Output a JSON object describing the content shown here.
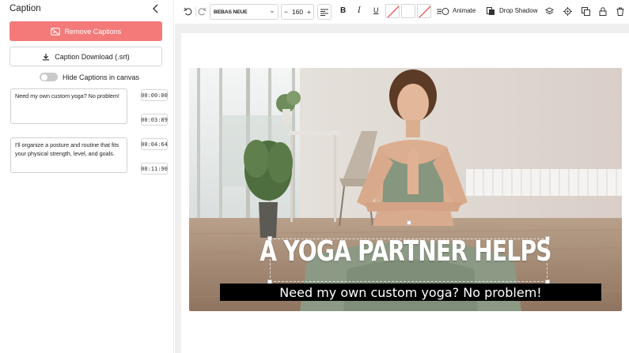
{
  "sidebar": {
    "title": "Caption",
    "remove_label": "Remove Captions",
    "download_label": "Caption Download (.srt)",
    "toggle_label": "Hide Captions in canvas",
    "toggle_on": false,
    "captions": [
      {
        "text": "Need my own custom yoga? No problem!",
        "start": "00:00:00",
        "end": "00:03:89"
      },
      {
        "text": "I'll organize a posture and routine that fits your physical strength, level, and goals.",
        "start": "00:04:64",
        "end": "00:11:90"
      }
    ]
  },
  "toolbar": {
    "font": "BEBAS NEUE",
    "font_size": "160",
    "bold": "B",
    "italic": "I",
    "underline": "U",
    "animate_label": "Animate",
    "drop_shadow_label": "Drop Shadow"
  },
  "canvas": {
    "headline": "A YOGA PARTNER HELPS",
    "subtitle": "Need my own custom yoga? No problem!"
  },
  "colors": {
    "accent": "#f47a7a",
    "subtitle_bg": "#000000"
  }
}
